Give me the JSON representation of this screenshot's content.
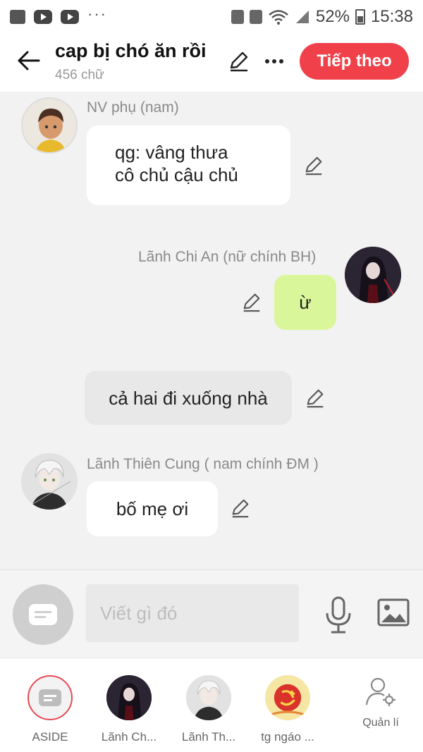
{
  "status_bar": {
    "battery": "52%",
    "time": "15:38"
  },
  "header": {
    "title": "cap bị chó ăn rồi",
    "subtitle": "456 chữ",
    "next_label": "Tiếp theo"
  },
  "messages": [
    {
      "speaker": "NV phụ (nam)",
      "lines": [
        "qg: vâng thưa",
        "cô chủ cậu chủ"
      ],
      "side": "left",
      "avatar_icon": "npc-boy-avatar"
    },
    {
      "speaker": "Lãnh Chi An (nữ chính BH)",
      "lines": [
        "ừ"
      ],
      "side": "right",
      "avatar_icon": "dark-hair-girl-avatar"
    },
    {
      "speaker": "",
      "lines": [
        "cả hai đi xuống nhà"
      ],
      "side": "narration"
    },
    {
      "speaker": "Lãnh Thiên Cung ( nam chính ĐM )",
      "lines": [
        "bố mẹ ơi"
      ],
      "side": "left",
      "avatar_icon": "white-hair-boy-avatar"
    }
  ],
  "input": {
    "placeholder": "Viết gì đó"
  },
  "characters": [
    {
      "label": "ASIDE",
      "icon": "aside-icon"
    },
    {
      "label": "Lãnh Ch...",
      "icon": "dark-hair-girl-avatar"
    },
    {
      "label": "Lãnh Th...",
      "icon": "white-hair-boy-avatar"
    },
    {
      "label": "tg ngáo ...",
      "icon": "emblem-avatar"
    }
  ],
  "manage_label": "Quản lí",
  "colors": {
    "accent": "#f0414a",
    "right_bubble": "#d9f79a",
    "narration_bubble": "#e8e8e8",
    "background": "#f2f2f2"
  }
}
